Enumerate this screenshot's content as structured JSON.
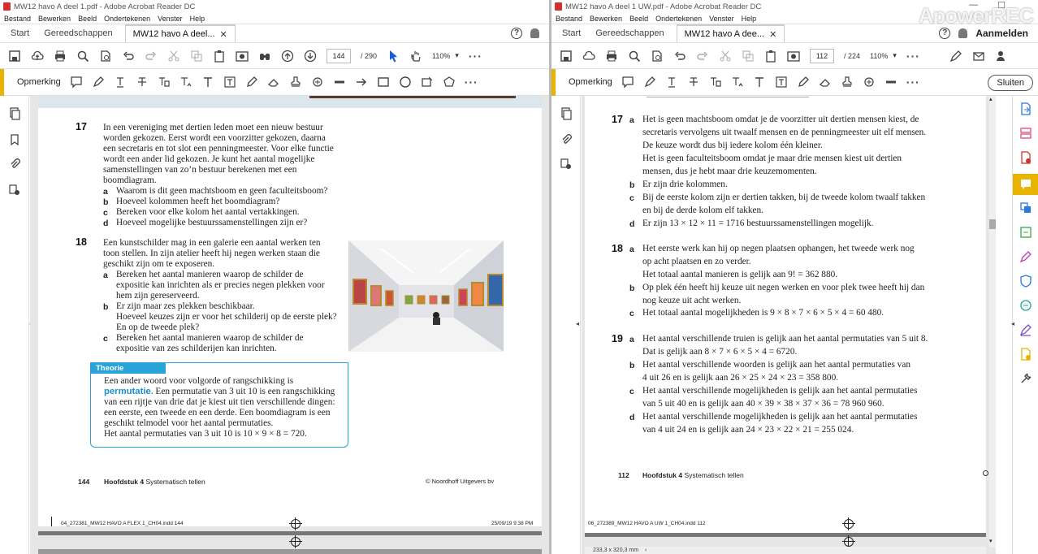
{
  "left": {
    "title": "MW12 havo A deel 1.pdf - Adobe Acrobat Reader DC",
    "menu": [
      "Bestand",
      "Bewerken",
      "Beeld",
      "Ondertekenen",
      "Venster",
      "Help"
    ],
    "tabs": {
      "home": "Start",
      "tools": "Gereedschappen",
      "doc": "MW12 havo A deel..."
    },
    "page_current": "144",
    "page_total": "/ 290",
    "zoom": "110%",
    "comment_label": "Opmerking",
    "q17": {
      "num": "17",
      "lines": [
        "In een vereniging met dertien leden moet een nieuw bestuur",
        "worden gekozen. Eerst wordt een voorzitter gekozen, daarna",
        "een secretaris en tot slot een penningmeester. Voor elke functie",
        "wordt een ander lid gekozen. Je kunt het aantal mogelijke",
        "samenstellingen van zo’n bestuur berekenen met een",
        "boomdiagram."
      ],
      "items": [
        {
          "l": "a",
          "t": "Waarom is dit geen machtsboom en geen faculteitsboom?"
        },
        {
          "l": "b",
          "t": "Hoeveel kolommen heeft het boomdiagram?"
        },
        {
          "l": "c",
          "t": "Bereken voor elke kolom het aantal vertakkingen."
        },
        {
          "l": "d",
          "t": "Hoeveel mogelijke bestuurssamenstellingen zijn er?"
        }
      ]
    },
    "q18": {
      "num": "18",
      "lines": [
        "Een kunstschilder mag in een galerie een aantal werken ten",
        "toon stellen. In zijn atelier heeft hij negen werken staan die",
        "geschikt zijn om te exposeren."
      ],
      "a": [
        "Bereken het aantal manieren waarop de schilder de",
        "expositie kan inrichten als er precies negen plekken voor",
        "hem zijn gereserveerd."
      ],
      "b": [
        "Er zijn maar zes plekken beschikbaar.",
        "Hoeveel keuzes zijn er voor het schilderij op de eerste plek?",
        "En op de tweede plek?"
      ],
      "c": [
        "Bereken het aantal manieren waarop de schilder de",
        "expositie van zes schilderijen kan inrichten."
      ]
    },
    "theory": {
      "head": "Theorie",
      "l1": "Een ander woord voor volgorde of rangschikking is",
      "term": "permutatie",
      "l2": ". Een permutatie van 3 uit 10 is een rangschikking",
      "l3": "van een rijtje van drie dat je kiest uit tien verschillende dingen:",
      "l4": "een eerste, een tweede en een derde. Een boomdiagram is een",
      "l5": "geschikt telmodel voor het aantal permutaties.",
      "l6": "Het aantal permutaties van 3 uit 10 is 10 × 9 × 8 = 720."
    },
    "footer": {
      "page": "144",
      "chapter": "Hoofdstuk 4",
      "chapter_title": "Systematisch tellen",
      "copyright": "© Noordhoff Uitgevers bv"
    },
    "slug": {
      "file": "04_272381_MW12 HAVO A FLEX 1_CH04.indd   144",
      "date": "25/09/19   9:38 PM"
    }
  },
  "right": {
    "title": "MW12 havo A deel 1 UW.pdf - Adobe Acrobat Reader DC",
    "menu": [
      "Bestand",
      "Bewerken",
      "Beeld",
      "Ondertekenen",
      "Venster",
      "Help"
    ],
    "tabs": {
      "home": "Start",
      "tools": "Gereedschappen",
      "doc": "MW12 havo A dee..."
    },
    "signin": "Aanmelden",
    "page_current": "112",
    "page_total": "/ 224",
    "zoom": "110%",
    "comment_label": "Opmerking",
    "close": "Sluiten",
    "watermark": "ApowerREC",
    "a17": {
      "num": "17",
      "a": [
        "Het is geen machtsboom omdat je de voorzitter uit dertien mensen kiest, de",
        "secretaris vervolgens uit twaalf mensen en de penningmeester uit elf mensen.",
        "De keuze wordt dus bij iedere kolom één kleiner.",
        "Het is geen faculteitsboom omdat je maar drie mensen kiest uit dertien",
        "mensen, dus je hebt maar drie keuzemomenten."
      ],
      "b": [
        "Er zijn drie kolommen."
      ],
      "c": [
        "Bij de eerste kolom zijn er dertien takken, bij de tweede kolom twaalf takken",
        "en bij de derde kolom elf takken."
      ],
      "d": [
        "Er zijn 13 × 12 × 11 = 1716 bestuurssamenstellingen mogelijk."
      ]
    },
    "a18": {
      "num": "18",
      "a": [
        "Het eerste werk kan hij op negen plaatsen ophangen, het tweede werk nog",
        "op acht plaatsen en zo verder.",
        "Het totaal aantal manieren is gelijk aan 9! = 362 880."
      ],
      "b": [
        "Op plek één heeft hij keuze uit negen werken en voor plek twee heeft hij dan",
        "nog keuze uit acht werken."
      ],
      "c": [
        "Het totaal aantal mogelijkheden is 9 × 8 × 7 × 6 × 5 × 4 = 60 480."
      ]
    },
    "a19": {
      "num": "19",
      "a": [
        "Het aantal verschillende truien is gelijk aan het aantal permutaties van 5 uit 8.",
        "Dat is gelijk aan 8 × 7 × 6 × 5 × 4 = 6720."
      ],
      "b": [
        "Het aantal verschillende woorden is gelijk aan het aantal permutaties van",
        "4 uit 26 en is gelijk aan 26 × 25 × 24 × 23 = 358 800."
      ],
      "c": [
        "Het aantal verschillende mogelijkheden is gelijk aan het aantal permutaties",
        "van 5 uit 40 en is gelijk aan 40 × 39 × 38 × 37 × 36 = 78 960 960."
      ],
      "d": [
        "Het aantal verschillende mogelijkheden is gelijk aan het aantal permutaties",
        "van 4 uit 24 en is gelijk aan 24 × 23 × 22 × 21 = 255 024."
      ]
    },
    "footer": {
      "page": "112",
      "chapter": "Hoofdstuk 4",
      "chapter_title": "Systematisch tellen"
    },
    "slug": {
      "file": "06_272389_MW12 HAVO A UW 1_CH04.indd   112"
    },
    "status": "233,3 x 320,3 mm"
  }
}
